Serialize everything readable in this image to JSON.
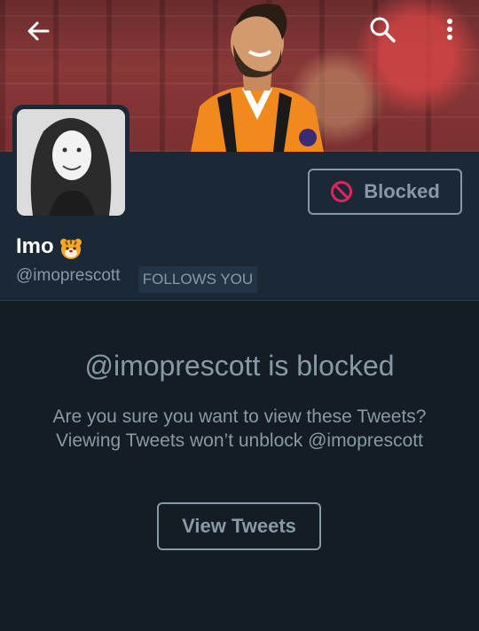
{
  "profile": {
    "display_name": "Imo",
    "name_emoji": "tiger-face-emoji",
    "handle": "@imoprescott",
    "follows_you_badge": "FOLLOWS YOU"
  },
  "actions": {
    "blocked_label": "Blocked",
    "view_tweets_label": "View Tweets"
  },
  "blocked_notice": {
    "title": "@imoprescott is blocked",
    "message": "Are you sure you want to view these Tweets? Viewing Tweets won’t unblock @imoprescott"
  },
  "icons": {
    "back": "arrow-left-icon",
    "search": "search-icon",
    "more": "more-vertical-icon",
    "blocked": "block-icon"
  },
  "colors": {
    "background": "#141d26",
    "header_panel": "#1b2836",
    "muted_text": "#8899a6",
    "block_icon": "#e0245e"
  }
}
